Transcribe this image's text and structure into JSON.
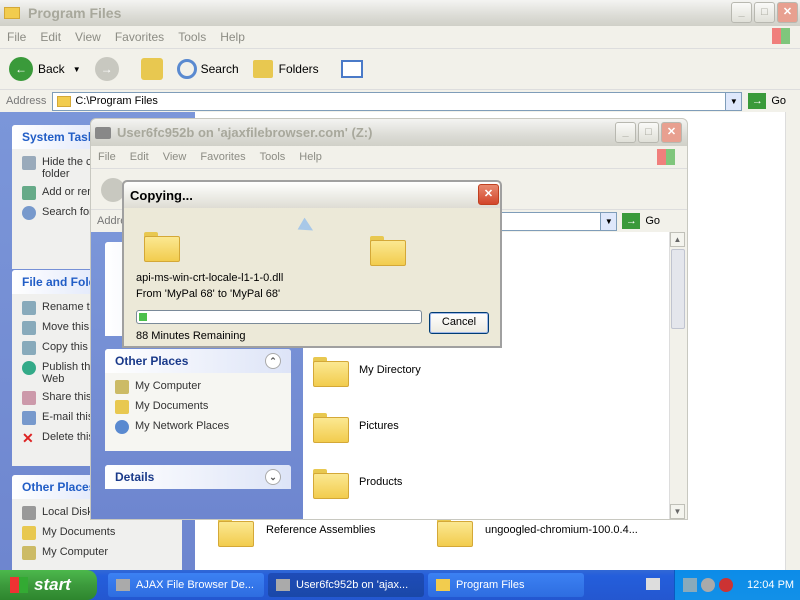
{
  "back_window": {
    "title": "Program Files",
    "menu": [
      "File",
      "Edit",
      "View",
      "Favorites",
      "Tools",
      "Help"
    ],
    "toolbar": {
      "back": "Back",
      "search": "Search",
      "folders": "Folders"
    },
    "address_label": "Address",
    "address_value": "C:\\Program Files",
    "go": "Go",
    "tasks_header": "System Tasks",
    "tasks": [
      "Hide the contents of this folder",
      "Add or remove programs",
      "Search for files or folders"
    ],
    "file_header": "File and Folder Tasks",
    "file_tasks": [
      "Rename this folder",
      "Move this folder",
      "Copy this folder",
      "Publish this folder to the Web",
      "Share this folder",
      "E-mail this folder's files",
      "Delete this folder"
    ],
    "other_header": "Other Places",
    "other": [
      "Local Disk (C:)",
      "My Documents",
      "My Computer"
    ],
    "files": [
      "Reference Assemblies",
      "ungoogled-chromium-100.0.4..."
    ]
  },
  "front_window": {
    "title": "User6fc952b on 'ajaxfilebrowser.com' (Z:)",
    "menu": [
      "File",
      "Edit",
      "View",
      "Favorites",
      "Tools",
      "Help"
    ],
    "address_label": "Address",
    "go": "Go",
    "other_header": "Other Places",
    "other": [
      "My Computer",
      "My Documents",
      "My Network Places"
    ],
    "details_header": "Details",
    "folders": [
      "My Directory",
      "Pictures",
      "Products"
    ]
  },
  "dialog": {
    "title": "Copying...",
    "filename": "api-ms-win-crt-locale-l1-1-0.dll",
    "from_to": "From 'MyPal 68' to 'MyPal 68'",
    "remaining": "88 Minutes Remaining",
    "cancel": "Cancel",
    "progress": 0.03
  },
  "taskbar": {
    "start": "start",
    "tasks": [
      "AJAX File Browser De...",
      "User6fc952b on 'ajax...",
      "Program Files"
    ],
    "clock": "12:04 PM"
  },
  "colors": {
    "taskbar": "#245edb",
    "start": "#3c9a3c",
    "progress": "#4cc04c"
  }
}
